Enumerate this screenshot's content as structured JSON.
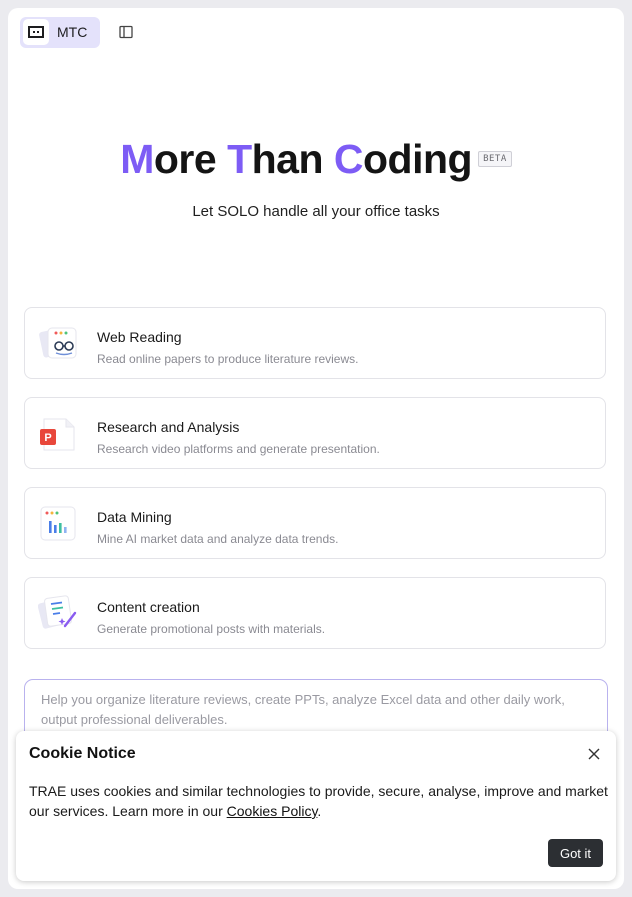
{
  "header": {
    "chip_label": "MTC",
    "logo_icon": "trae-logo-icon",
    "sidebar_toggle_icon": "sidebar-panel-icon"
  },
  "hero": {
    "title_parts": [
      {
        "text": "M",
        "accent": true
      },
      {
        "text": "ore ",
        "accent": false
      },
      {
        "text": "T",
        "accent": true
      },
      {
        "text": "han ",
        "accent": false
      },
      {
        "text": "C",
        "accent": true
      },
      {
        "text": "oding",
        "accent": false
      }
    ],
    "badge": "BETA",
    "subtitle": "Let SOLO handle all your office tasks",
    "accent_color": "#7d5cf5"
  },
  "cards": [
    {
      "title": "Web Reading",
      "desc": "Read online papers to produce literature reviews.",
      "icon": "web-reading-icon"
    },
    {
      "title": "Research and Analysis",
      "desc": "Research video platforms and generate presentation.",
      "icon": "presentation-icon"
    },
    {
      "title": "Data Mining",
      "desc": "Mine AI market data and analyze data trends.",
      "icon": "chart-icon"
    },
    {
      "title": "Content creation",
      "desc": "Generate promotional posts with materials.",
      "icon": "content-creation-icon"
    }
  ],
  "prompt": {
    "placeholder": "Help you organize literature reviews, create PPTs, analyze Excel data and other daily work, output professional deliverables."
  },
  "cookie": {
    "title": "Cookie Notice",
    "text": "TRAE uses cookies and similar technologies to provide, secure, analyse, improve and market our services. Learn more in our ",
    "link_label": "Cookies Policy",
    "text_end": ".",
    "button_label": "Got it",
    "close_icon": "close-icon"
  }
}
